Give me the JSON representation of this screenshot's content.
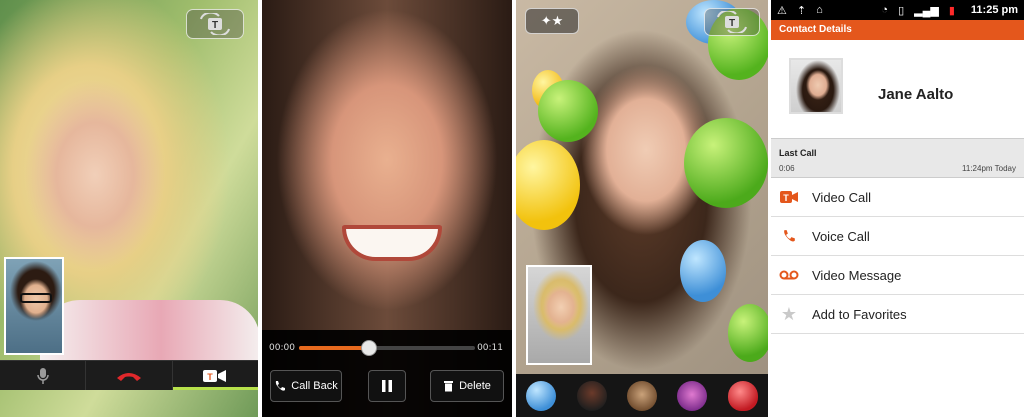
{
  "panel1": {
    "switch_camera_label": "T",
    "callbar": {
      "mute_icon": "microphone-icon",
      "end_call_icon": "hangup-icon",
      "video_icon": "video-camera-icon"
    }
  },
  "panel2": {
    "elapsed": "00:00",
    "duration": "00:11",
    "progress_percent": 40,
    "call_back_label": "Call Back",
    "delete_label": "Delete"
  },
  "panel3": {
    "effects": [
      "balloons",
      "ninja",
      "monkey",
      "devil",
      "heart"
    ]
  },
  "contact": {
    "status_time": "11:25",
    "status_ampm": "pm",
    "title": "Contact Details",
    "name": "Jane Aalto",
    "last_call": {
      "heading": "Last Call",
      "duration": "0:06",
      "time": "11:24pm Today"
    },
    "actions": [
      {
        "label": "Video Call",
        "icon": "video-call-icon"
      },
      {
        "label": "Voice Call",
        "icon": "phone-icon"
      },
      {
        "label": "Video Message",
        "icon": "voicemail-icon"
      },
      {
        "label": "Add to Favorites",
        "icon": "star-icon"
      }
    ],
    "accent": "#e4571c"
  }
}
